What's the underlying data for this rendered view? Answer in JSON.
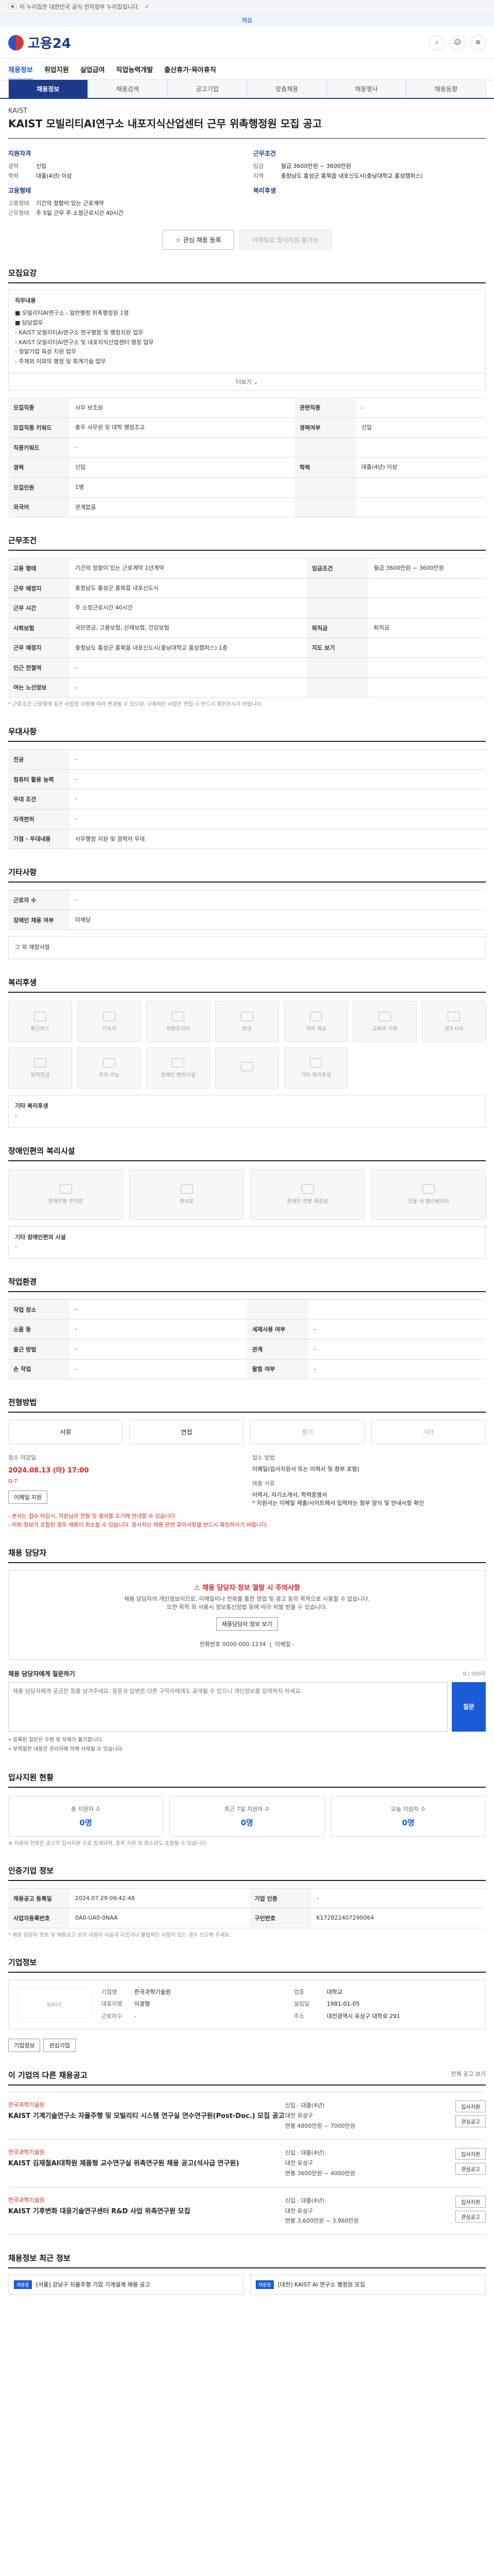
{
  "gov_banner": {
    "text": "이 누리집은 대한민국 공식 전자정부 누리집입니다.",
    "toggle": "✓"
  },
  "notice_bar": {
    "text": "해설"
  },
  "header": {
    "logo": "고용24"
  },
  "gnb": [
    "채용정보",
    "취업지원",
    "실업급여",
    "직업능력개발",
    "출산휴가·육아휴직"
  ],
  "tabs": [
    "채용정보",
    "채용검색",
    "공고기업",
    "맞춤채용",
    "채용행사",
    "채용동향"
  ],
  "job": {
    "company": "KAIST",
    "title": "KAIST 모빌리티AI연구소 내포지식산업센터 근무 위촉행정원 모집 공고"
  },
  "summary": {
    "left_title": "지원자격",
    "right_title": "근무조건",
    "left_rows": [
      {
        "k": "경력",
        "v": "신입"
      },
      {
        "k": "학력",
        "v": "대졸(4년) 이상"
      }
    ],
    "right_rows": [
      {
        "k": "임금",
        "v": "월급 3600만원 ~ 3600만원"
      },
      {
        "k": "지역",
        "v": "충청남도 홍성군 홍북읍 내포신도시(충남대학교 홍성캠퍼스)"
      }
    ],
    "left_title2": "고용형태",
    "right_title2": "복리후생",
    "left_rows2": [
      {
        "k": "고용형태",
        "v": "기간의 정함이 있는 근로계약"
      },
      {
        "k": "근무형태",
        "v": "주 5일 근무 주 소정근로시간 40시간"
      }
    ]
  },
  "buttons": {
    "apply": "관심 채용 등록",
    "online": "이메일로 입사지원 불가능"
  },
  "recruit": {
    "heading": "모집요강",
    "desc_title": "직무내용",
    "desc": "■ 모빌리티AI연구소 : 일반행정 위촉행정원 1명\n■ 담당업무\n- KAIST 모빌리티AI연구소 연구행정 및 행정지원 업무\n- KAIST 모빌리티AI연구소 및 내포지식산업센터 행정 업무\n- 정말기업 육성 지원 업무\n- 주제와 이외의 행정 및 회계기술 업무",
    "more": "더보기",
    "rows": [
      {
        "k1": "모집직종",
        "v1": "사무 보조원",
        "k2": "관련직종",
        "v2": "-"
      },
      {
        "k1": "모집직종 키워드",
        "v1": "총무 사무원 및 대학 행정조교",
        "k2": "경력여부",
        "v2": "신입"
      },
      {
        "k1": "직종키워드",
        "v1": "-",
        "k2": "",
        "v2": ""
      },
      {
        "k1": "경력",
        "v1": "신입",
        "k2": "학력",
        "v2": "대졸(4년) 이상"
      },
      {
        "k1": "모집인원",
        "v1": "1명",
        "k2": "",
        "v2": ""
      },
      {
        "k1": "외국어",
        "v1": "관계없음",
        "k2": "",
        "v2": ""
      }
    ]
  },
  "cond": {
    "heading": "근무조건",
    "rows": [
      {
        "k1": "고용 형태",
        "v1": "기간의 정함이 있는 근로계약 1년계약",
        "k2": "임금조건",
        "v2": "월급 3600만원 ~ 3600만원"
      },
      {
        "k1": "근무 예정지",
        "v1": "충청남도 홍성군 홍북읍 내포신도시",
        "k2": "",
        "v2": ""
      },
      {
        "k1": "근무 시간",
        "v1": "주 소정근로시간 40시간",
        "k2": "",
        "v2": ""
      },
      {
        "k1": "사회보험",
        "v1": "국민연금, 고용보험, 산재보험, 건강보험",
        "k2": "퇴직금",
        "v2": "퇴직금"
      },
      {
        "k1": "근무 예정지",
        "v1": "충청남도 홍성군 홍북읍 내포신도시(충남대학교 홍성캠퍼스) 1층",
        "k2": "지도 보기",
        "v2": ""
      },
      {
        "k1": "인근 전철역",
        "v1": "-",
        "k2": "",
        "v2": ""
      },
      {
        "k1": "여는 노선정보",
        "v1": "-",
        "k2": "",
        "v2": ""
      }
    ],
    "note": "* 근로조건·근로형태 등은 사업장 사정에 따라 변경될 수 있으며, 구체적인 사항은 면접 시 반드시 확인하시기 바랍니다."
  },
  "pref": {
    "heading": "우대사항",
    "rows": [
      {
        "k": "전공",
        "v": "-"
      },
      {
        "k": "컴퓨터 활용 능력",
        "v": "-"
      },
      {
        "k": "우대 조건",
        "v": "-"
      },
      {
        "k": "자격면허",
        "v": "-"
      },
      {
        "k": "가점 · 우대내용",
        "v": "사무행정 지원 및 경력자 우대"
      }
    ]
  },
  "other": {
    "heading": "기타사항",
    "rows": [
      {
        "k": "근로자 수",
        "v": "-"
      },
      {
        "k": "장애인 채용 여부",
        "v": "미해당"
      }
    ],
    "more": "그 외 재량사항"
  },
  "benefits": {
    "heading": "복리후생",
    "items": [
      "통근버스",
      "기숙사",
      "차량유지비",
      "연금",
      "식비 제공",
      "교육비 지원",
      "경조사비",
      "퇴직연금",
      "주차 가능",
      "장애인 편의시설",
      "",
      "기타 복리후생"
    ],
    "note_title": "기타 복리후생",
    "note": "-"
  },
  "disability": {
    "heading": "장애인편의 복리시설",
    "items": [
      "장애인용 주차장",
      "경사로",
      "장애인 전용 화장실",
      "건물 내 엘리베이터"
    ],
    "note_title": "기타 장애인편의 시설",
    "note": "-"
  },
  "company_cond": {
    "heading": "작업환경",
    "rows": [
      {
        "k1": "작업 장소",
        "v1": "-",
        "k2": "",
        "v2": ""
      },
      {
        "k1": "소음 등",
        "v1": "-",
        "k2": "세제사용 여부",
        "v2": "-"
      },
      {
        "k1": "출근 방법",
        "v1": "-",
        "k2": "관계",
        "v2": "-"
      },
      {
        "k1": "손 작업",
        "v1": "-",
        "k2": "팔힘 여부",
        "v2": "-"
      }
    ]
  },
  "apply": {
    "heading": "전형방법",
    "methods": [
      "서류",
      "면접",
      "필기",
      "기타"
    ],
    "deadline_label": "접수 마감일",
    "deadline": "2024.08.13 (마) 17:00",
    "deadline_note": "D-7",
    "method_label": "접수 방법",
    "method": "이메일(입사지원서 또는 이력서 및 첨부 포함)",
    "docs_label": "제출 서류",
    "docs": "이력서, 자기소개서, 학력증명서\n* 지원서는 이메일 제출/사이트에서 입력하는 첨부 양식 및 안내사항 확인",
    "map_btn": "이메일 지원",
    "notes": "- 본사는 접수 마감시, 지원님과 전형 및 결과를 조기에 안내할 수 있습니다.\n- 허위 정보가 포함된 경우 채용이 취소될 수 있습니다. 응시자는 채용 관련 유의사항을 반드시 확인하시기 바랍니다."
  },
  "contact": {
    "heading": "채용 담당자",
    "warn": "채용 담당자 정보 열람 시 주의사항",
    "desc": "채용 담당자의 개인정보이므로, 이메일이나 전화를 통한 영업 및 광고 등의 목적으로 사용할 수 없습니다.\n또한 목적 외 사용시 정보통신망법 등에 따라 처벌 받을 수 있습니다.",
    "btn": "채용담당자 정보 보기",
    "phone_label": "전화번호",
    "phone": "0000-000-1234",
    "email_label": "이메일",
    "email": "-"
  },
  "question": {
    "title": "채용 담당자에게 질문하기",
    "limit": "0 / 500자",
    "placeholder": "채용 담당자에게 궁금한 점을 남겨주세요. 질문과 답변은 다른 구직자에게도 공개될 수 있으니 개인정보를 입력하지 마세요.",
    "send": "질문",
    "notes": [
      "• 등록된 질문은 수정 및 삭제가 불가합니다.",
      "• 부적절한 내용은 관리자에 의해 삭제될 수 있습니다."
    ]
  },
  "status": {
    "heading": "입사지원 현황",
    "items": [
      {
        "l": "총 지원자 수",
        "v": "0명"
      },
      {
        "l": "최근 7일 지원자 수",
        "v": "0명"
      },
      {
        "l": "오늘 지원자 수",
        "v": "0명"
      }
    ],
    "note": "※ 지원자 현황은 공고의 입사지원 수로 집계되며, 중복 지원 및 취소자도 포함될 수 있습니다."
  },
  "info": {
    "heading": "인증기업 정보",
    "rows": [
      {
        "k1": "채용공고 등록일",
        "v1": "2024.07.29 09:42:48",
        "k2": "기업 인증",
        "v2": "-"
      },
      {
        "k1": "사업자등록번호",
        "v1": "0A0-UA0-0NAA",
        "k2": "구인번호",
        "v2": "K172822407290064"
      }
    ],
    "note": "* 채용 담당자 정보 및 채용공고 상의 내용이 사실과 다르거나 불법적인 사항이 있는 경우 신고해 주세요."
  },
  "companyinfo": {
    "heading": "기업정보",
    "logo": "KAIST",
    "rows": [
      {
        "k": "기업명",
        "v": "한국과학기술원"
      },
      {
        "k": "업종",
        "v": "대학교"
      },
      {
        "k": "대표자명",
        "v": "이광형"
      },
      {
        "k": "설립일",
        "v": "1981-01-05"
      },
      {
        "k": "근로자수",
        "v": "-"
      },
      {
        "k": "주소",
        "v": "대전광역시 유성구 대학로 291"
      }
    ],
    "btns": [
      "기업정보",
      "관심기업"
    ]
  },
  "related": {
    "heading": "이 기업의 다른 채용공고",
    "more": "전체 공고 보기",
    "items": [
      {
        "co": "한국과학기술원",
        "title": "KAIST 기계기술연구소 자율주행 및 모빌리티 시스템 연구실 연수연구원(Post-Doc.) 모집 공고",
        "meta": "신입 · 대졸(4년)\n대전 유성구\n연봉 4800만원 ~ 7000만원",
        "btns": [
          "입사지원",
          "관심공고"
        ]
      },
      {
        "co": "한국과학기술원",
        "title": "KAIST 김재철AI대학원 제품형 교수연구실 위촉연구원 채용 공고(석사급 연구원)",
        "meta": "신입 · 대졸(4년)\n대전 유성구\n연봉 3600만원 ~ 4000만원",
        "btns": [
          "입사지원",
          "관심공고"
        ]
      },
      {
        "co": "한국과학기술원",
        "title": "KAIST 기후변화 대응기술연구센터 R&D 사업 위촉연구원 모집",
        "meta": "신입 · 대졸(4년)\n대전 유성구\n연봉 3,600만원 ~ 3,960만원",
        "btns": [
          "입사지원",
          "관심공고"
        ]
      }
    ]
  },
  "bottom": {
    "heading": "채용정보 최근 정보",
    "items": [
      {
        "badge": "채용중",
        "text": "[서울] 강남구 자율주행 기업 기계설계 채용 공고"
      },
      {
        "badge": "채용중",
        "text": "[대전] KAIST AI 연구소 행정원 모집"
      }
    ]
  }
}
